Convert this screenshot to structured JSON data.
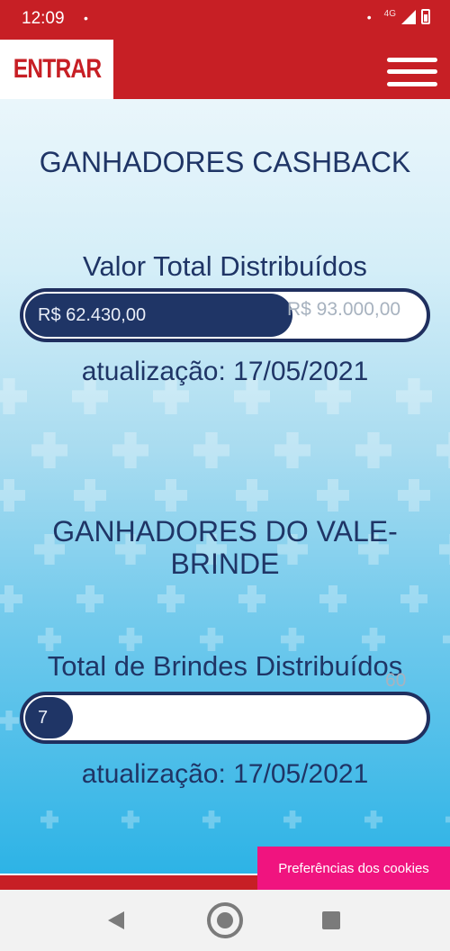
{
  "status_bar": {
    "time": "12:09",
    "network": "4G"
  },
  "header": {
    "login_label": "ENTRAR",
    "brand_color": "#c71f25"
  },
  "cashback": {
    "title": "GANHADORES CASHBACK",
    "subtitle": "Valor Total Distribuídos",
    "current_value": "R$ 62.430,00",
    "goal_value": "R$ 93.000,00",
    "progress_fraction": 0.67,
    "updated": "atualização: 17/05/2021"
  },
  "vale_brinde": {
    "title_line1": "GANHADORES DO VALE-",
    "title_line2": "BRINDE",
    "subtitle": "Total de Brindes Distribuídos",
    "current_value": "7",
    "goal_value": "60",
    "progress_fraction": 0.12,
    "updated": "atualização: 17/05/2021"
  },
  "cookie_button": {
    "label": "Preferências dos cookies",
    "color": "#f0147f"
  },
  "accent_color": "#1f3566"
}
